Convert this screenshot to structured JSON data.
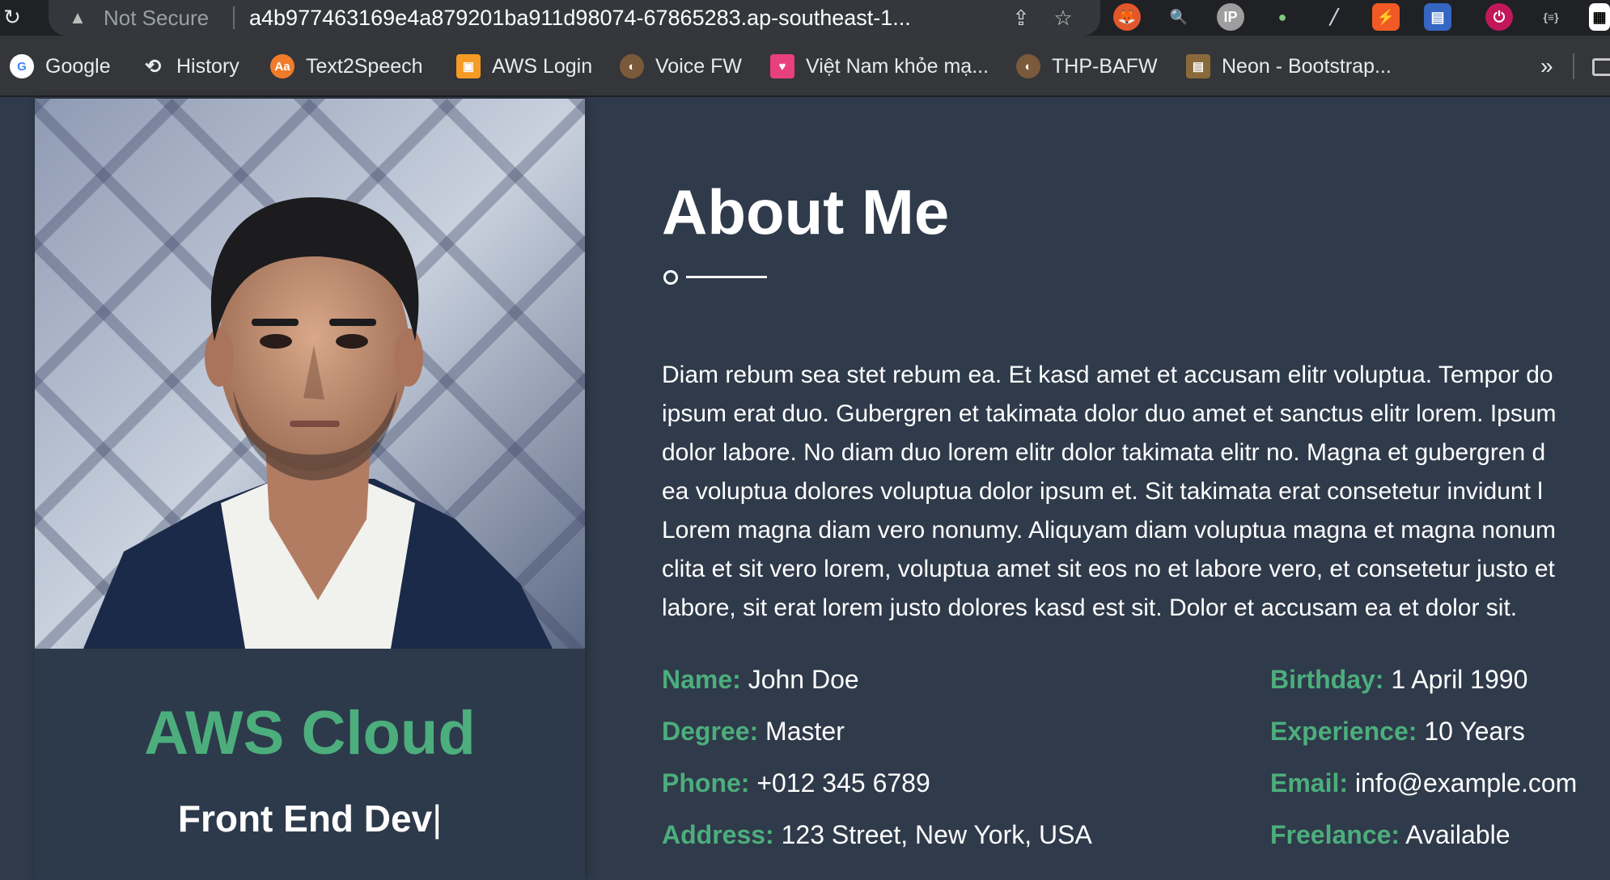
{
  "browser": {
    "not_secure_label": "Not Secure",
    "url": "a4b977463169e4a879201ba911d98074-67865283.ap-southeast-1...",
    "extension_icon_names": [
      "fox-icon",
      "magnifier-icon",
      "ip-icon",
      "map-pin-icon",
      "dropper-icon",
      "bookmark-icon",
      "notebook-icon",
      "power-icon",
      "json-icon",
      "qr-icon"
    ]
  },
  "bookmarks": [
    {
      "label": "Google",
      "icon": "google-icon",
      "color": "#4285f4",
      "glyph": "G"
    },
    {
      "label": "History",
      "icon": "history-icon",
      "color": "#35363a",
      "glyph": "⟲"
    },
    {
      "label": "Text2Speech",
      "icon": "text2speech-icon",
      "color": "#f07c2a",
      "glyph": "Aa"
    },
    {
      "label": "AWS Login",
      "icon": "aws-cube-icon",
      "color": "#f59a23",
      "glyph": "▣"
    },
    {
      "label": "Voice FW",
      "icon": "voice-fw-icon",
      "color": "#7a5a3a",
      "glyph": "◐"
    },
    {
      "label": "Việt Nam khỏe mạ...",
      "icon": "heart-icon",
      "color": "#e8407c",
      "glyph": "♥"
    },
    {
      "label": "THP-BAFW",
      "icon": "thp-icon",
      "color": "#7a5a3a",
      "glyph": "◐"
    },
    {
      "label": "Neon - Bootstrap...",
      "icon": "neon-icon",
      "color": "#8a6a3a",
      "glyph": "▤"
    }
  ],
  "bookmarks_more": "»",
  "profile": {
    "brand_title": "AWS Cloud",
    "role": "Front End Dev",
    "caret": "|"
  },
  "about": {
    "title": "About Me",
    "paragraph_lines": [
      "Diam rebum sea stet rebum ea. Et kasd amet et accusam elitr voluptua. Tempor do",
      "ipsum erat duo. Gubergren et takimata dolor duo amet et sanctus elitr lorem. Ipsum",
      "dolor labore. No diam duo lorem elitr dolor takimata elitr no. Magna et gubergren d",
      "ea voluptua dolores voluptua dolor ipsum et. Sit takimata erat consetetur invidunt l",
      "Lorem magna diam vero nonumy. Aliquyam diam voluptua magna et magna nonum",
      "clita et sit vero lorem, voluptua amet sit eos no et labore vero, et consetetur justo et",
      "labore, sit erat lorem justo dolores kasd est sit. Dolor et accusam ea et dolor sit."
    ]
  },
  "info": {
    "name": {
      "label": "Name:",
      "value": "John Doe"
    },
    "degree": {
      "label": "Degree:",
      "value": "Master"
    },
    "phone": {
      "label": "Phone:",
      "value": "+012 345 6789"
    },
    "address": {
      "label": "Address:",
      "value": "123 Street, New York, USA"
    },
    "birthday": {
      "label": "Birthday:",
      "value": "1 April 1990"
    },
    "experience": {
      "label": "Experience:",
      "value": "10 Years"
    },
    "email": {
      "label": "Email:",
      "value": "info@example.com"
    },
    "freelance": {
      "label": "Freelance:",
      "value": "Available"
    }
  },
  "colors": {
    "accent": "#4cae7c",
    "page_bg": "#2f3a4a",
    "card_bg": "#2d3a4b"
  }
}
